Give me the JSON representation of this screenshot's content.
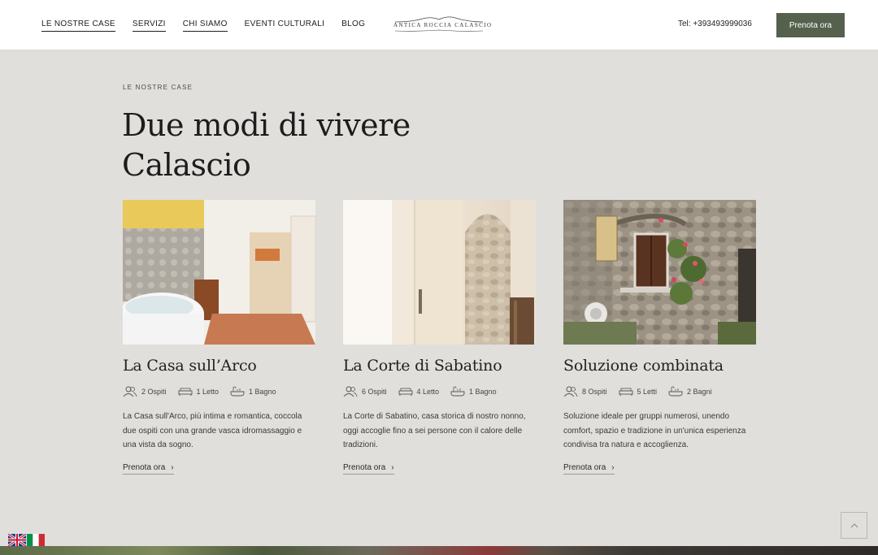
{
  "nav": {
    "items": [
      {
        "label": "LE NOSTRE CASE"
      },
      {
        "label": "SERVIZI"
      },
      {
        "label": "CHI SIAMO"
      },
      {
        "label": "EVENTI CULTURALI"
      },
      {
        "label": "BLOG"
      }
    ],
    "logo_text": "ANTICA ROCCIA CALASCIO",
    "phone": "Tel: +393493999036",
    "book_label": "Prenota ora"
  },
  "section": {
    "eyebrow": "LE NOSTRE CASE",
    "title": "Due modi di vivere Calascio"
  },
  "cards": [
    {
      "name": "La Casa sull’Arco",
      "guests": "2 Ospiti",
      "beds": "1 Letto",
      "baths": "1 Bagno",
      "description": "La Casa sull'Arco, più intima e romantica, coccola due ospiti con una grande vasca idromassaggio e una vista da sogno.",
      "cta": "Prenota ora"
    },
    {
      "name": "La Corte di Sabatino",
      "guests": "6 Ospiti",
      "beds": "4 Letto",
      "baths": "1 Bagno",
      "description": "La Corte di Sabatino, casa storica di nostro nonno, oggi accoglie fino a sei persone con il calore delle tradizioni.",
      "cta": "Prenota ora"
    },
    {
      "name": "Soluzione combinata",
      "guests": "8 Ospiti",
      "beds": "5 Letti",
      "baths": "2 Bagni",
      "description": "Soluzione ideale per gruppi numerosi, unendo comfort, spazio e tradizione in un'unica esperienza condivisa tra natura e accoglienza.",
      "cta": "Prenota ora"
    }
  ],
  "icons": {
    "guests": "users-icon",
    "beds": "bed-icon",
    "baths": "bathtub-icon",
    "scroll_top": "chevron-up-icon"
  },
  "colors": {
    "accent": "#55614c",
    "background": "#e0dfdb"
  }
}
